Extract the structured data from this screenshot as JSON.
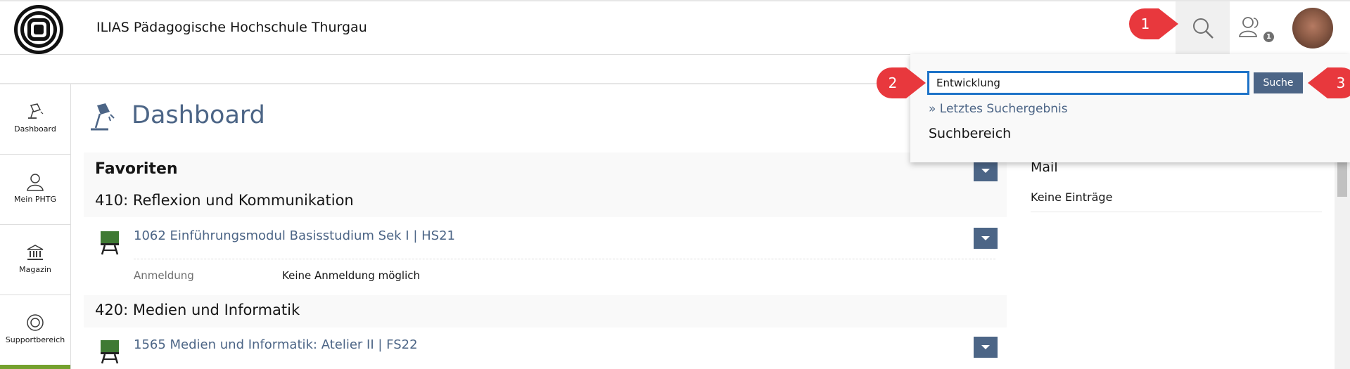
{
  "header": {
    "site_title": "ILIAS Pädagogische Hochschule Thurgau",
    "notification_count": "1"
  },
  "nav": {
    "items": [
      {
        "label": "Dashboard",
        "icon": "lamp-icon"
      },
      {
        "label": "Mein PHTG",
        "icon": "user-icon"
      },
      {
        "label": "Magazin",
        "icon": "building-icon"
      },
      {
        "label": "Supportbereich",
        "icon": "lifebuoy-icon"
      }
    ]
  },
  "page": {
    "title": "Dashboard"
  },
  "favorites": {
    "title": "Favoriten",
    "groups": [
      {
        "title": "410: Reflexion und Kommunikation",
        "items": [
          {
            "link": "1062 Einführungsmodul Basisstudium Sek I | HS21",
            "prop_label": "Anmeldung",
            "prop_value": "Keine Anmeldung möglich"
          }
        ]
      },
      {
        "title": "420: Medien und Informatik",
        "items": [
          {
            "link": "1565 Medien und Informatik: Atelier II | FS22"
          }
        ]
      }
    ]
  },
  "mail": {
    "title": "Mail",
    "empty_text": "Keine Einträge"
  },
  "search": {
    "value": "Entwicklung",
    "submit_label": "Suche",
    "last_result_link": "» Letztes Suchergebnis",
    "scope_label": "Suchbereich"
  },
  "callouts": [
    "1",
    "2",
    "3"
  ],
  "colors": {
    "accent": "#4c6586",
    "callout": "#e8383d",
    "focus": "#1e73c8",
    "nav_active": "#74a12e"
  }
}
